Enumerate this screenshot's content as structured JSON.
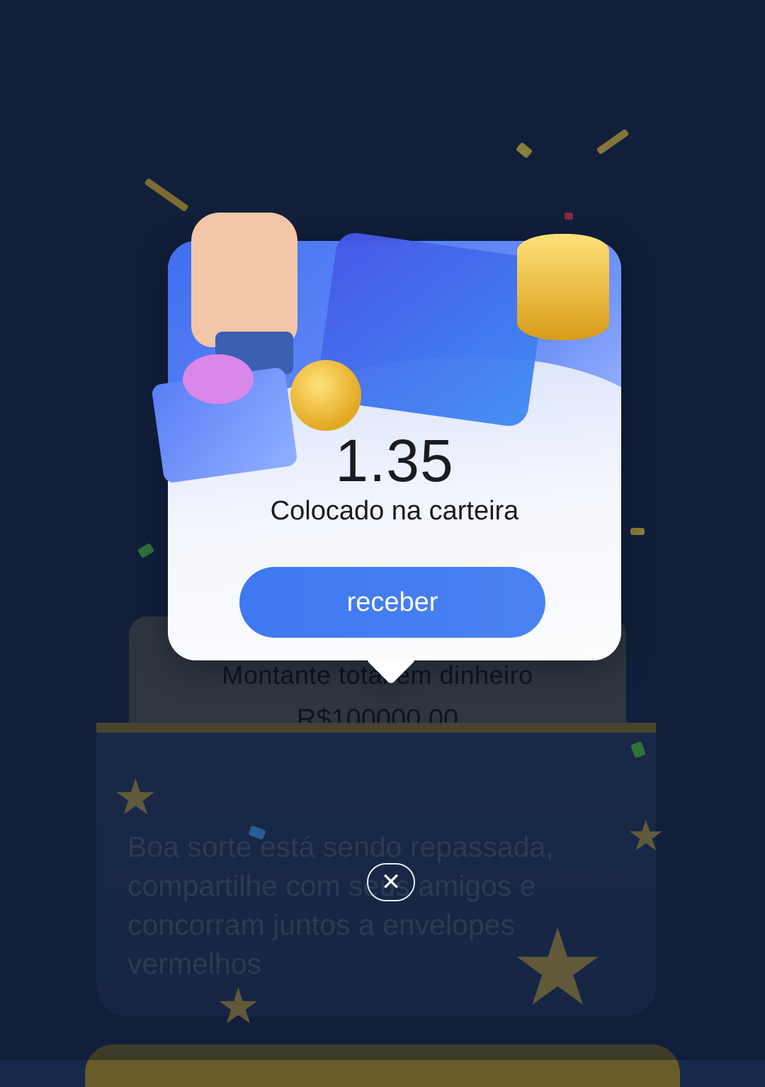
{
  "reward": {
    "amount": "1.35",
    "subtitle": "Colocado na carteira",
    "button_label": "receber"
  },
  "background": {
    "total_label": "Montante total em dinheiro",
    "total_value": "R$100000.00",
    "share_text": "Boa sorte está sendo repassada, compartilhe com seus amigos e concorram juntos a envelopes vermelhos"
  },
  "close": {
    "icon": "close-icon",
    "glyph": "✕"
  },
  "icons": {
    "hand": "rock-hand-icon",
    "gift": "gift-box-icon",
    "coins": "gold-coins-icon",
    "cube": "money-cube-icon"
  },
  "colors": {
    "primary_button": "#3f78ef",
    "card_header": "#3f6ff0",
    "background": "#16294b"
  }
}
